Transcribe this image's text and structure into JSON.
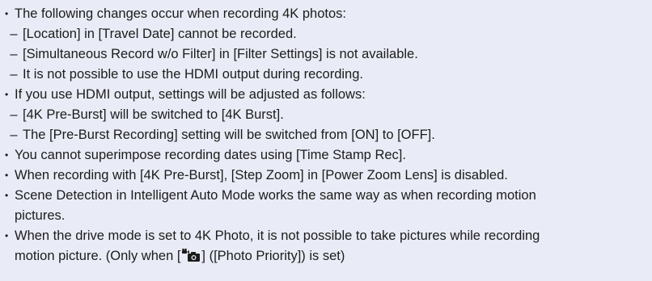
{
  "notes": {
    "b1": "The following changes occur when recording 4K photos:",
    "b1_sub1": "[Location] in [Travel Date] cannot be recorded.",
    "b1_sub2": "[Simultaneous Record w/o Filter] in [Filter Settings] is not available.",
    "b1_sub3": "It is not possible to use the HDMI output during recording.",
    "b2": "If you use HDMI output, settings will be adjusted as follows:",
    "b2_sub1": "[4K Pre-Burst] will be switched to [4K Burst].",
    "b2_sub2": "The [Pre-Burst Recording] setting will be switched from [ON] to [OFF].",
    "b3": "You cannot superimpose recording dates using [Time Stamp Rec].",
    "b4": "When recording with [4K Pre-Burst], [Step Zoom] in [Power Zoom Lens] is disabled.",
    "b5_line1": "Scene Detection in Intelligent Auto Mode works the same way as when recording motion",
    "b5_line2": "pictures.",
    "b6_line1": "When the drive mode is set to 4K Photo, it is not possible to take pictures while recording",
    "b6_line2_before": "motion picture. (Only when [",
    "b6_line2_icon": "photo-priority-icon",
    "b6_line2_after": "] ([Photo Priority]) is set)"
  },
  "glyphs": {
    "bullet": "•",
    "dash": "–"
  },
  "colors": {
    "background": "#e9ecf6",
    "text": "#1c1c1c"
  }
}
